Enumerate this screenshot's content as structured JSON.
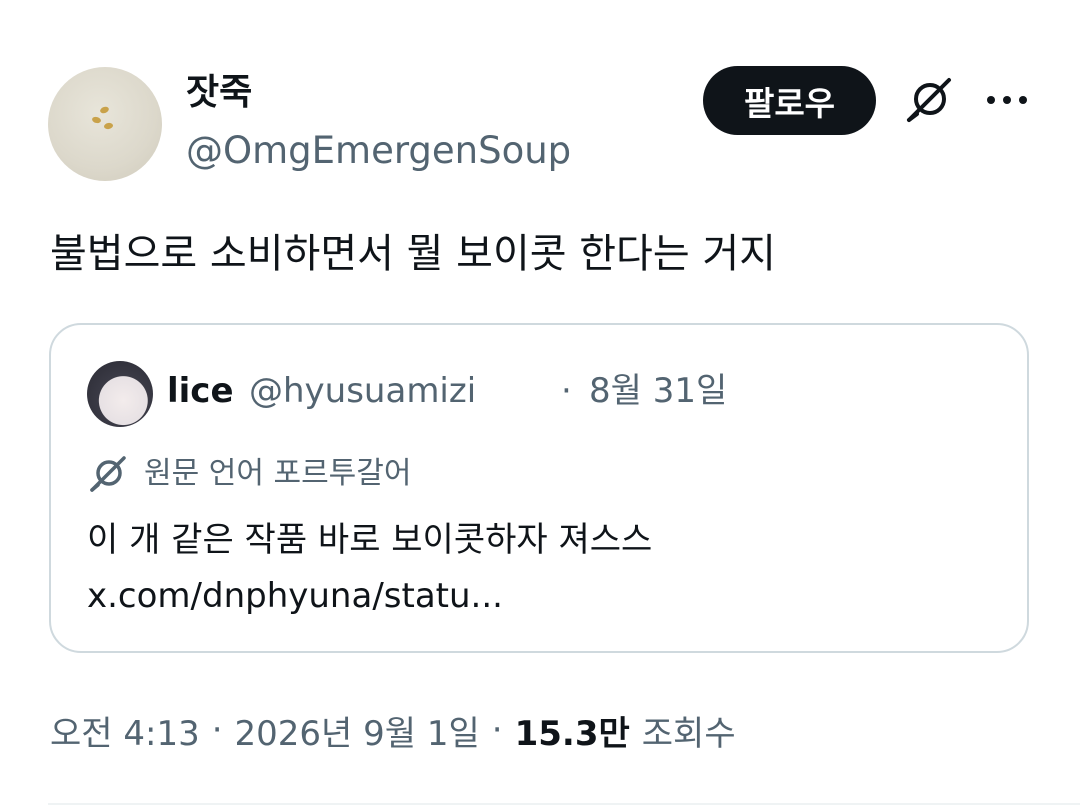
{
  "author": {
    "display_name": "잣죽",
    "handle": "@OmgEmergenSoup"
  },
  "actions": {
    "follow_label": "팔로우",
    "translate_icon": "translate-icon",
    "more_icon": "more-icon"
  },
  "tweet": {
    "text": "불법으로 소비하면서 뭘 보이콧 한다는 거지"
  },
  "quote": {
    "name": "lice",
    "handle": "@hyusuamizi",
    "dot": "·",
    "date": "8월 31일",
    "translate_label": "원문 언어 포르투갈어",
    "text": "이 개 같은 작품 바로 보이콧하자 져스스",
    "link": "x.com/dnphyuna/statu..."
  },
  "meta": {
    "time": "오전 4:13",
    "sep1": "·",
    "date": "2026년 9월 1일",
    "sep2": "·",
    "views_count": "15.3만",
    "views_label": "조회수"
  },
  "colors": {
    "text_primary": "#0f1419",
    "text_secondary": "#536471",
    "border": "#cfd9de",
    "button_bg": "#0f1419"
  }
}
